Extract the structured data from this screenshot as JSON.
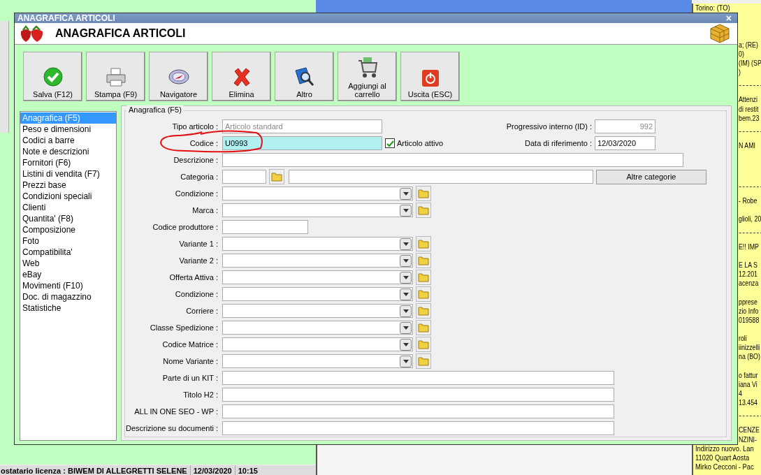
{
  "window": {
    "title": "ANAGRAFICA ARTICOLI",
    "heading": "ANAGRAFICA ARTICOLI",
    "close": "×"
  },
  "toolbar": [
    {
      "label": "Salva (F12)",
      "kind": "save"
    },
    {
      "label": "Stampa (F9)",
      "kind": "print"
    },
    {
      "label": "Navigatore",
      "kind": "navigator"
    },
    {
      "label": "Elimina",
      "kind": "delete"
    },
    {
      "label": "Altro",
      "kind": "more"
    },
    {
      "label": "Aggiungi al carrello",
      "kind": "cart"
    },
    {
      "label": "Uscita (ESC)",
      "kind": "exit"
    }
  ],
  "sidebar": {
    "items": [
      {
        "label": "Anagrafica (F5)",
        "selected": true
      },
      {
        "label": "Peso e dimensioni",
        "selected": false
      },
      {
        "label": "Codici a barre",
        "selected": false
      },
      {
        "label": "Note e descrizioni",
        "selected": false
      },
      {
        "label": "Fornitori (F6)",
        "selected": false
      },
      {
        "label": "Listini di vendita (F7)",
        "selected": false
      },
      {
        "label": "Prezzi base",
        "selected": false
      },
      {
        "label": "Condizioni speciali",
        "selected": false
      },
      {
        "label": "Clienti",
        "selected": false
      },
      {
        "label": "Quantita' (F8)",
        "selected": false
      },
      {
        "label": "Composizione",
        "selected": false
      },
      {
        "label": "Foto",
        "selected": false
      },
      {
        "label": "Compatibilita'",
        "selected": false
      },
      {
        "label": "Web",
        "selected": false
      },
      {
        "label": "eBay",
        "selected": false
      },
      {
        "label": "Movimenti (F10)",
        "selected": false
      },
      {
        "label": "Doc. di magazzino",
        "selected": false
      },
      {
        "label": "Statistiche",
        "selected": false
      }
    ]
  },
  "form": {
    "legend": "Anagrafica (F5)",
    "rows": [
      {
        "label": "Tipo articolo :",
        "kind": "text",
        "value": "Articolo standard",
        "disabled": true,
        "side": {
          "label": "Progressivo interno (ID) :",
          "value": "992",
          "disabled": true
        }
      },
      {
        "label": "Codice :",
        "kind": "text",
        "value": "U0993",
        "disabled": false,
        "circled": true,
        "checkbox": {
          "label": "Articolo attivo",
          "checked": true
        },
        "side": {
          "label": "Data di riferimento :",
          "value": "12/03/2020",
          "disabled": false
        }
      },
      {
        "label": "Descrizione :",
        "kind": "wide"
      },
      {
        "label": "Categoria :",
        "kind": "category",
        "button": "Altre categorie"
      },
      {
        "label": "Condizione :",
        "kind": "combo"
      },
      {
        "label": "Marca :",
        "kind": "combo"
      },
      {
        "label": "Codice produttore :",
        "kind": "short"
      },
      {
        "label": "Variante 1 :",
        "kind": "combo"
      },
      {
        "label": "Variante 2 :",
        "kind": "combo"
      },
      {
        "label": "Offerta Attiva :",
        "kind": "combo"
      },
      {
        "label": "Condizione :",
        "kind": "combo"
      },
      {
        "label": "Corriere :",
        "kind": "combo"
      },
      {
        "label": "Classe Spedizione :",
        "kind": "combo"
      },
      {
        "label": "Codice Matrice :",
        "kind": "combo"
      },
      {
        "label": "Nome Variante :",
        "kind": "combo"
      },
      {
        "label": "Parte di un KIT :",
        "kind": "long"
      },
      {
        "label": "Titolo H2 :",
        "kind": "long"
      },
      {
        "label": "ALL IN ONE SEO - WP :",
        "kind": "long"
      },
      {
        "label": "Descrizione su documenti :",
        "kind": "long"
      }
    ]
  },
  "notes_panel": {
    "lines": [
      {
        "kind": "full",
        "text": "Torino: (TO)"
      },
      {
        "kind": "gap"
      },
      {
        "kind": "gap"
      },
      {
        "kind": "gap"
      },
      {
        "kind": "clipped",
        "text": "a; (RE)"
      },
      {
        "kind": "clipped",
        "text": "0)"
      },
      {
        "kind": "clipped",
        "text": "(IM) (SP"
      },
      {
        "kind": "clipped",
        "text": ")"
      },
      {
        "kind": "rule"
      },
      {
        "kind": "gap"
      },
      {
        "kind": "clipped",
        "text": "Attenzi"
      },
      {
        "kind": "clipped",
        "text": "di restit"
      },
      {
        "kind": "clipped",
        "text": "bem.23"
      },
      {
        "kind": "rule"
      },
      {
        "kind": "gap"
      },
      {
        "kind": "clipped",
        "text": "N AMI"
      },
      {
        "kind": "gap"
      },
      {
        "kind": "gap"
      },
      {
        "kind": "gap"
      },
      {
        "kind": "rule"
      },
      {
        "kind": "gap"
      },
      {
        "kind": "clipped",
        "text": "- Robe"
      },
      {
        "kind": "gap"
      },
      {
        "kind": "clipped",
        "text": "glioli, 20"
      },
      {
        "kind": "rule"
      },
      {
        "kind": "gap"
      },
      {
        "kind": "clipped",
        "text": "E!! IMP"
      },
      {
        "kind": "gap"
      },
      {
        "kind": "clipped",
        "text": "E LA S"
      },
      {
        "kind": "clipped",
        "text": "12.201"
      },
      {
        "kind": "clipped",
        "text": "acenza"
      },
      {
        "kind": "gap"
      },
      {
        "kind": "clipped",
        "text": "pprese"
      },
      {
        "kind": "clipped",
        "text": "zio Info"
      },
      {
        "kind": "clipped",
        "text": "019588"
      },
      {
        "kind": "gap"
      },
      {
        "kind": "clipped",
        "text": "roli"
      },
      {
        "kind": "clipped",
        "text": "iinizzelli"
      },
      {
        "kind": "clipped",
        "text": "na (BO)"
      },
      {
        "kind": "gap"
      },
      {
        "kind": "clipped",
        "text": "o fattur"
      },
      {
        "kind": "clipped",
        "text": "iana Vi"
      },
      {
        "kind": "clipped",
        "text": "4"
      },
      {
        "kind": "clipped",
        "text": "13.454"
      },
      {
        "kind": "rule"
      },
      {
        "kind": "gap"
      },
      {
        "kind": "clipped",
        "text": "CENZE"
      },
      {
        "kind": "clipped",
        "text": "NZINI-"
      },
      {
        "kind": "full",
        "text": "Indirizzo nuovo. Lan"
      },
      {
        "kind": "full",
        "text": "11020 Quart Aosta"
      },
      {
        "kind": "full",
        "text": "Mirko Cecconi - Pac"
      }
    ]
  },
  "status_bar": [
    "ostatario licenza : BIWEM DI ALLEGRETTI SELENE",
    "12/03/2020",
    "10:15"
  ]
}
